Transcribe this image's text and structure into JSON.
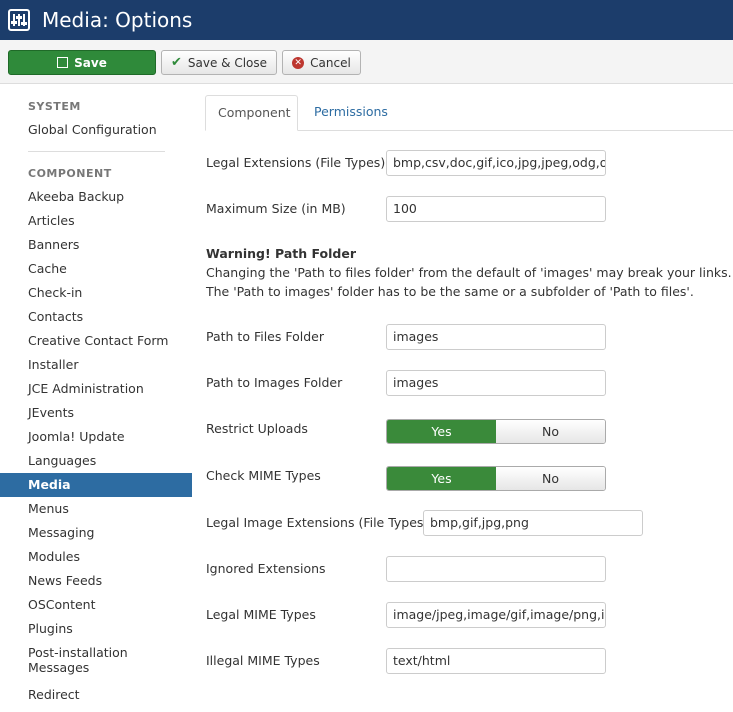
{
  "header": {
    "title": "Media: Options"
  },
  "toolbar": {
    "save_label": "Save",
    "save_close_label": "Save & Close",
    "cancel_label": "Cancel"
  },
  "sidebar": {
    "system_heading": "SYSTEM",
    "global_config": "Global Configuration",
    "component_heading": "COMPONENT",
    "items": [
      "Akeeba Backup",
      "Articles",
      "Banners",
      "Cache",
      "Check-in",
      "Contacts",
      "Creative Contact Form",
      "Installer",
      "JCE Administration",
      "JEvents",
      "Joomla! Update",
      "Languages",
      "Media",
      "Menus",
      "Messaging",
      "Modules",
      "News Feeds",
      "OSContent",
      "Plugins",
      "Post-installation",
      "Messages",
      "Redirect"
    ],
    "active_item": "Media"
  },
  "tabs": {
    "component": "Component",
    "permissions": "Permissions"
  },
  "form": {
    "legal_ext_label": "Legal Extensions (File Types)",
    "legal_ext_value": "bmp,csv,doc,gif,ico,jpg,jpeg,odg,odp",
    "max_size_label": "Maximum Size (in MB)",
    "max_size_value": "100",
    "warning_title": "Warning! Path Folder",
    "warning_line1": "Changing the 'Path to files folder' from the default of 'images' may break your links.",
    "warning_line2": "The 'Path to images' folder has to be the same or a subfolder of 'Path to files'.",
    "files_folder_label": "Path to Files Folder",
    "files_folder_value": "images",
    "images_folder_label": "Path to Images Folder",
    "images_folder_value": "images",
    "restrict_label": "Restrict Uploads",
    "check_mime_label": "Check MIME Types",
    "yes": "Yes",
    "no": "No",
    "legal_img_ext_label": "Legal Image Extensions (File Types)",
    "legal_img_ext_value": "bmp,gif,jpg,png",
    "ignored_ext_label": "Ignored Extensions",
    "ignored_ext_value": "",
    "legal_mime_label": "Legal MIME Types",
    "legal_mime_value": "image/jpeg,image/gif,image/png,image/bmp",
    "illegal_mime_label": "Illegal MIME Types",
    "illegal_mime_value": "text/html"
  }
}
